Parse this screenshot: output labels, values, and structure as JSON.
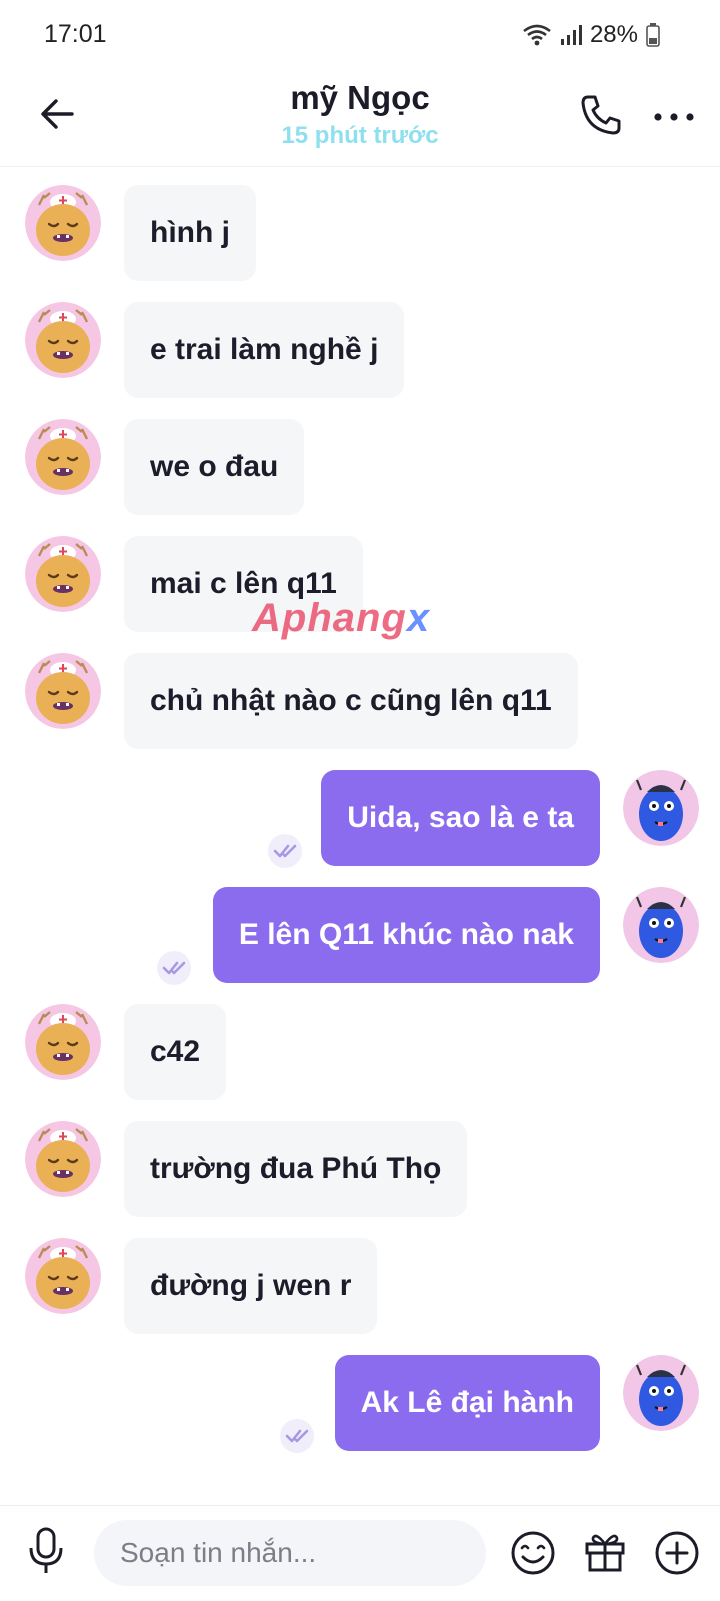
{
  "status_bar": {
    "time": "17:01",
    "battery": "28%"
  },
  "header": {
    "name": "mỹ Ngọc",
    "last_seen": "15 phút trước"
  },
  "watermark": {
    "part1": "Aphang",
    "part2": "x"
  },
  "messages": [
    {
      "side": "in",
      "text": "hình j"
    },
    {
      "side": "in",
      "text": "e trai làm nghề j"
    },
    {
      "side": "in",
      "text": "we o đau"
    },
    {
      "side": "in",
      "text": "mai c lên q11"
    },
    {
      "side": "in",
      "text": "chủ nhật nào c cũng lên q11"
    },
    {
      "side": "out",
      "text": "Uida, sao là e ta",
      "seen": true
    },
    {
      "side": "out",
      "text": "E lên Q11 khúc nào nak",
      "seen": true
    },
    {
      "side": "in",
      "text": "c42"
    },
    {
      "side": "in",
      "text": "trường đua Phú Thọ"
    },
    {
      "side": "in",
      "text": "đường j wen r"
    },
    {
      "side": "out",
      "text": "Ak Lê đại hành",
      "seen": true
    }
  ],
  "composer": {
    "placeholder": "Soạn tin nhắn..."
  },
  "colors": {
    "outgoing_bubble": "#8b6cee",
    "incoming_bubble": "#f5f6f8",
    "last_seen": "#8fe0ef"
  },
  "icons": [
    "back-arrow-icon",
    "phone-icon",
    "more-icon",
    "mic-icon",
    "emoji-icon",
    "gift-icon",
    "plus-icon",
    "seen-check-icon"
  ]
}
